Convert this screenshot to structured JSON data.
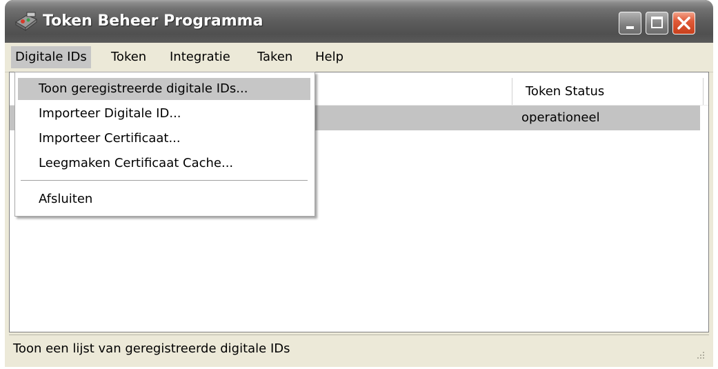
{
  "window": {
    "title": "Token Beheer Programma",
    "icon": "token-app-icon",
    "controls": [
      "minimize-icon",
      "maximize-icon",
      "close-icon"
    ]
  },
  "menubar": {
    "items": [
      {
        "label": "Digitale IDs",
        "active": true
      },
      {
        "label": "Token"
      },
      {
        "label": "Integratie"
      },
      {
        "label": "Taken"
      },
      {
        "label": "Help"
      }
    ]
  },
  "dropdown": {
    "items": [
      {
        "label": "Toon geregistreerde digitale IDs...",
        "highlighted": true
      },
      {
        "label": "Importeer Digitale ID..."
      },
      {
        "label": "Importeer Certificaat..."
      },
      {
        "label": "Leegmaken Certificaat Cache..."
      },
      {
        "label": "Afsluiten"
      }
    ]
  },
  "table": {
    "columns": [
      {
        "label": "Token Status"
      }
    ],
    "rows": [
      {
        "token_status": "operationeel",
        "selected": true
      }
    ]
  },
  "statusbar": {
    "text": "Toon een lijst van geregistreerde digitale IDs"
  },
  "colors": {
    "titlebar": "#5c5c5c",
    "menu_highlight": "#c6c6c6",
    "close_button": "#e05a38",
    "window_face": "#ece9d8"
  }
}
